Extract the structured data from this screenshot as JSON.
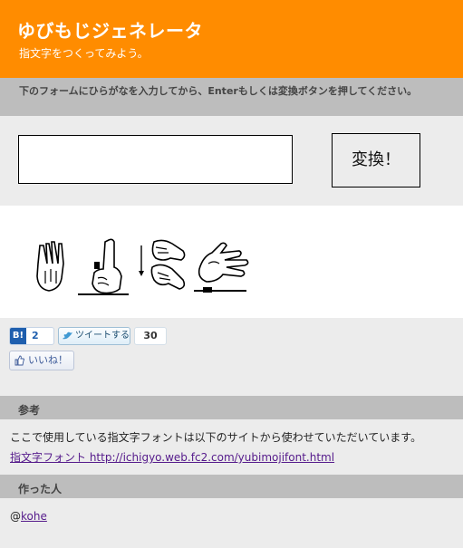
{
  "header": {
    "title": "ゆびもじジェネレータ",
    "subtitle": "指文字をつくってみよう。"
  },
  "instructions": "下のフォームにひらがなを入力してから、Enterもしくは変換ボタンを押してください。",
  "form": {
    "input_value": "",
    "input_placeholder": "",
    "convert_label": "変換！"
  },
  "result_glyphs": [
    "hand-sign-1-icon",
    "hand-sign-2-icon",
    "hand-sign-3-icon",
    "hand-sign-4-icon"
  ],
  "social": {
    "hatena_logo": "B!",
    "hatena_count": "2",
    "tweet_label": "ツイートする",
    "tweet_count": "30",
    "like_label": "いいね！"
  },
  "reference": {
    "heading": "参考",
    "text": "ここで使用している指文字フォントは以下のサイトから使わせていただいています。",
    "link_text": "指文字フォント http://ichigyo.web.fc2.com/yubimojifont.html"
  },
  "author": {
    "heading": "作った人",
    "prefix": "@",
    "handle": "kohe"
  },
  "colors": {
    "header_bg": "#ff8c00",
    "section_bar_bg": "#bdbdbd",
    "page_bg": "#ececec",
    "link": "#551a8b"
  }
}
